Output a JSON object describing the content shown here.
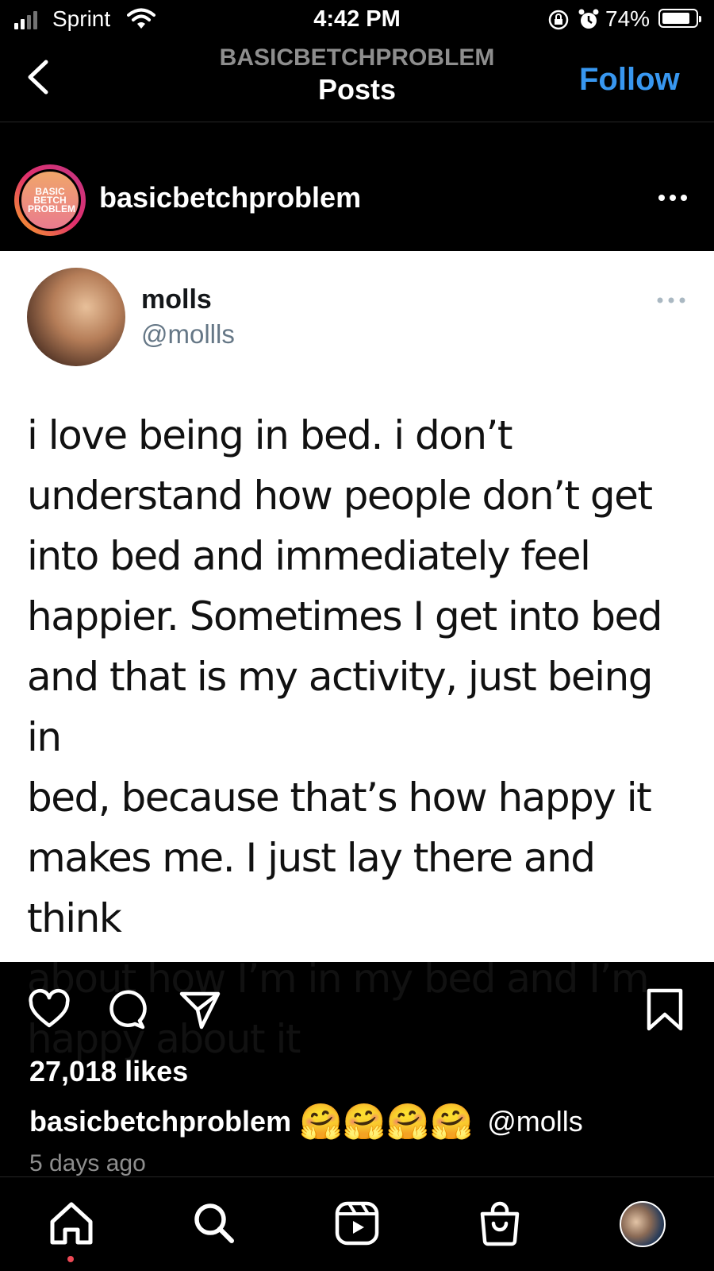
{
  "status_bar": {
    "carrier": "Sprint",
    "time": "4:42 PM",
    "battery_percent": "74%",
    "battery_level": 0.74,
    "icons": [
      "signal-icon",
      "wifi-icon",
      "rotation-lock-icon",
      "alarm-icon",
      "battery-icon"
    ]
  },
  "nav": {
    "account": "BASICBETCHPROBLEM",
    "title": "Posts",
    "follow_label": "Follow",
    "accent_color": "#3897f0"
  },
  "post": {
    "username": "basicbetchproblem",
    "avatar_text": "BASIC BETCH PROBLEM"
  },
  "tweet": {
    "name": "molls",
    "handle": "@mollls",
    "lines": [
      "i love being in bed. i don’t",
      "understand how people don’t get",
      "into bed and immediately feel",
      "happier. Sometimes I get into bed",
      "and that is my activity, just being in",
      "bed, because that’s how happy it",
      "makes me. I just lay there and think",
      "about how I’m in my bed and I’m",
      "happy about it"
    ]
  },
  "engagement": {
    "likes": "27,018 likes",
    "caption_user": "basicbetchproblem",
    "caption_emojis": "🤗🤗🤗🤗",
    "caption_mention": "@molls",
    "time_ago": "5 days ago"
  },
  "bottom_nav": {
    "tabs": [
      "home-icon",
      "search-icon",
      "reels-icon",
      "shop-icon",
      "profile-avatar"
    ]
  }
}
